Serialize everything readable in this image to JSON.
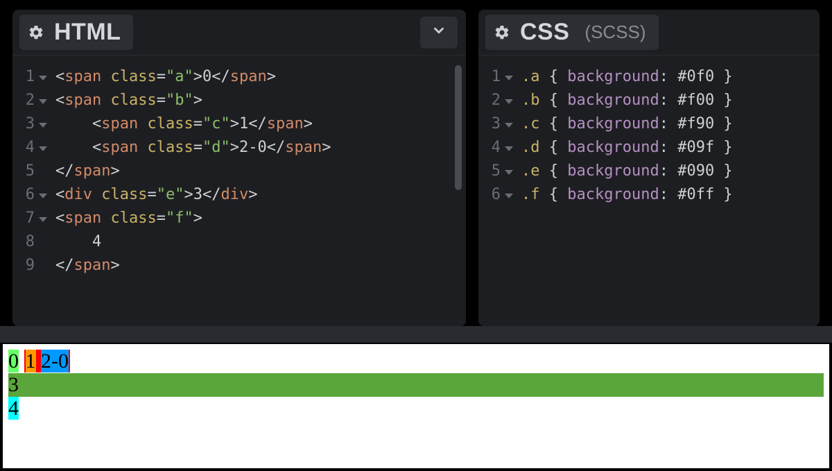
{
  "panels": {
    "html": {
      "title": "HTML",
      "sub": ""
    },
    "css": {
      "title": "CSS",
      "sub": "(SCSS)"
    }
  },
  "html_editor": {
    "line_numbers": [
      "1",
      "2",
      "3",
      "4",
      "5",
      "6",
      "7",
      "8",
      "9"
    ],
    "fold_lines": [
      1,
      2,
      3,
      4,
      6,
      7
    ],
    "lines": [
      {
        "indent": 0,
        "tokens": [
          {
            "t": "<",
            "c": "punct"
          },
          {
            "t": "span",
            "c": "tag"
          },
          {
            "t": " ",
            "c": "text"
          },
          {
            "t": "class",
            "c": "attr"
          },
          {
            "t": "=",
            "c": "eq"
          },
          {
            "t": "\"a\"",
            "c": "str"
          },
          {
            "t": ">",
            "c": "punct"
          },
          {
            "t": "0",
            "c": "text"
          },
          {
            "t": "</",
            "c": "punct"
          },
          {
            "t": "span",
            "c": "tag"
          },
          {
            "t": ">",
            "c": "punct"
          }
        ]
      },
      {
        "indent": 0,
        "tokens": [
          {
            "t": "<",
            "c": "punct"
          },
          {
            "t": "span",
            "c": "tag"
          },
          {
            "t": " ",
            "c": "text"
          },
          {
            "t": "class",
            "c": "attr"
          },
          {
            "t": "=",
            "c": "eq"
          },
          {
            "t": "\"b\"",
            "c": "str"
          },
          {
            "t": ">",
            "c": "punct"
          }
        ]
      },
      {
        "indent": 1,
        "tokens": [
          {
            "t": "<",
            "c": "punct"
          },
          {
            "t": "span",
            "c": "tag"
          },
          {
            "t": " ",
            "c": "text"
          },
          {
            "t": "class",
            "c": "attr"
          },
          {
            "t": "=",
            "c": "eq"
          },
          {
            "t": "\"c\"",
            "c": "str"
          },
          {
            "t": ">",
            "c": "punct"
          },
          {
            "t": "1",
            "c": "text"
          },
          {
            "t": "</",
            "c": "punct"
          },
          {
            "t": "span",
            "c": "tag"
          },
          {
            "t": ">",
            "c": "punct"
          }
        ]
      },
      {
        "indent": 1,
        "tokens": [
          {
            "t": "<",
            "c": "punct"
          },
          {
            "t": "span",
            "c": "tag"
          },
          {
            "t": " ",
            "c": "text"
          },
          {
            "t": "class",
            "c": "attr"
          },
          {
            "t": "=",
            "c": "eq"
          },
          {
            "t": "\"d\"",
            "c": "str"
          },
          {
            "t": ">",
            "c": "punct"
          },
          {
            "t": "2-0",
            "c": "text"
          },
          {
            "t": "</",
            "c": "punct"
          },
          {
            "t": "span",
            "c": "tag"
          },
          {
            "t": ">",
            "c": "punct"
          }
        ]
      },
      {
        "indent": 0,
        "tokens": [
          {
            "t": "</",
            "c": "punct"
          },
          {
            "t": "span",
            "c": "tag"
          },
          {
            "t": ">",
            "c": "punct"
          }
        ]
      },
      {
        "indent": 0,
        "tokens": [
          {
            "t": "<",
            "c": "punct"
          },
          {
            "t": "div",
            "c": "tag"
          },
          {
            "t": " ",
            "c": "text"
          },
          {
            "t": "class",
            "c": "attr"
          },
          {
            "t": "=",
            "c": "eq"
          },
          {
            "t": "\"e\"",
            "c": "str"
          },
          {
            "t": ">",
            "c": "punct"
          },
          {
            "t": "3",
            "c": "text"
          },
          {
            "t": "</",
            "c": "punct"
          },
          {
            "t": "div",
            "c": "tag"
          },
          {
            "t": ">",
            "c": "punct"
          }
        ]
      },
      {
        "indent": 0,
        "tokens": [
          {
            "t": "<",
            "c": "punct"
          },
          {
            "t": "span",
            "c": "tag"
          },
          {
            "t": " ",
            "c": "text"
          },
          {
            "t": "class",
            "c": "attr"
          },
          {
            "t": "=",
            "c": "eq"
          },
          {
            "t": "\"f\"",
            "c": "str"
          },
          {
            "t": ">",
            "c": "punct"
          }
        ]
      },
      {
        "indent": 1,
        "tokens": [
          {
            "t": "4",
            "c": "text"
          }
        ]
      },
      {
        "indent": 0,
        "tokens": [
          {
            "t": "</",
            "c": "punct"
          },
          {
            "t": "span",
            "c": "tag"
          },
          {
            "t": ">",
            "c": "punct"
          }
        ]
      }
    ]
  },
  "css_editor": {
    "line_numbers": [
      "1",
      "2",
      "3",
      "4",
      "5",
      "6"
    ],
    "fold_lines": [
      1,
      2,
      3,
      4,
      5,
      6
    ],
    "lines": [
      {
        "tokens": [
          {
            "t": ".a",
            "c": "sel"
          },
          {
            "t": " { ",
            "c": "brace"
          },
          {
            "t": "background",
            "c": "prop"
          },
          {
            "t": ": ",
            "c": "punct"
          },
          {
            "t": "#0f0",
            "c": "text"
          },
          {
            "t": " }",
            "c": "brace"
          }
        ]
      },
      {
        "tokens": [
          {
            "t": ".b",
            "c": "sel"
          },
          {
            "t": " { ",
            "c": "brace"
          },
          {
            "t": "background",
            "c": "prop"
          },
          {
            "t": ": ",
            "c": "punct"
          },
          {
            "t": "#f00",
            "c": "text"
          },
          {
            "t": " }",
            "c": "brace"
          }
        ]
      },
      {
        "tokens": [
          {
            "t": ".c",
            "c": "sel"
          },
          {
            "t": " { ",
            "c": "brace"
          },
          {
            "t": "background",
            "c": "prop"
          },
          {
            "t": ": ",
            "c": "punct"
          },
          {
            "t": "#f90",
            "c": "text"
          },
          {
            "t": " }",
            "c": "brace"
          }
        ]
      },
      {
        "tokens": [
          {
            "t": ".d",
            "c": "sel"
          },
          {
            "t": " { ",
            "c": "brace"
          },
          {
            "t": "background",
            "c": "prop"
          },
          {
            "t": ": ",
            "c": "punct"
          },
          {
            "t": "#09f",
            "c": "text"
          },
          {
            "t": " }",
            "c": "brace"
          }
        ]
      },
      {
        "tokens": [
          {
            "t": ".e",
            "c": "sel"
          },
          {
            "t": " { ",
            "c": "brace"
          },
          {
            "t": "background",
            "c": "prop"
          },
          {
            "t": ": ",
            "c": "punct"
          },
          {
            "t": "#090",
            "c": "text"
          },
          {
            "t": " }",
            "c": "brace"
          }
        ]
      },
      {
        "tokens": [
          {
            "t": ".f",
            "c": "sel"
          },
          {
            "t": " { ",
            "c": "brace"
          },
          {
            "t": "background",
            "c": "prop"
          },
          {
            "t": ": ",
            "c": "punct"
          },
          {
            "t": "#0ff",
            "c": "text"
          },
          {
            "t": " }",
            "c": "brace"
          }
        ]
      }
    ]
  },
  "preview": {
    "a": "0",
    "c": "1",
    "d": "2-0",
    "e": "3",
    "f": "4"
  }
}
